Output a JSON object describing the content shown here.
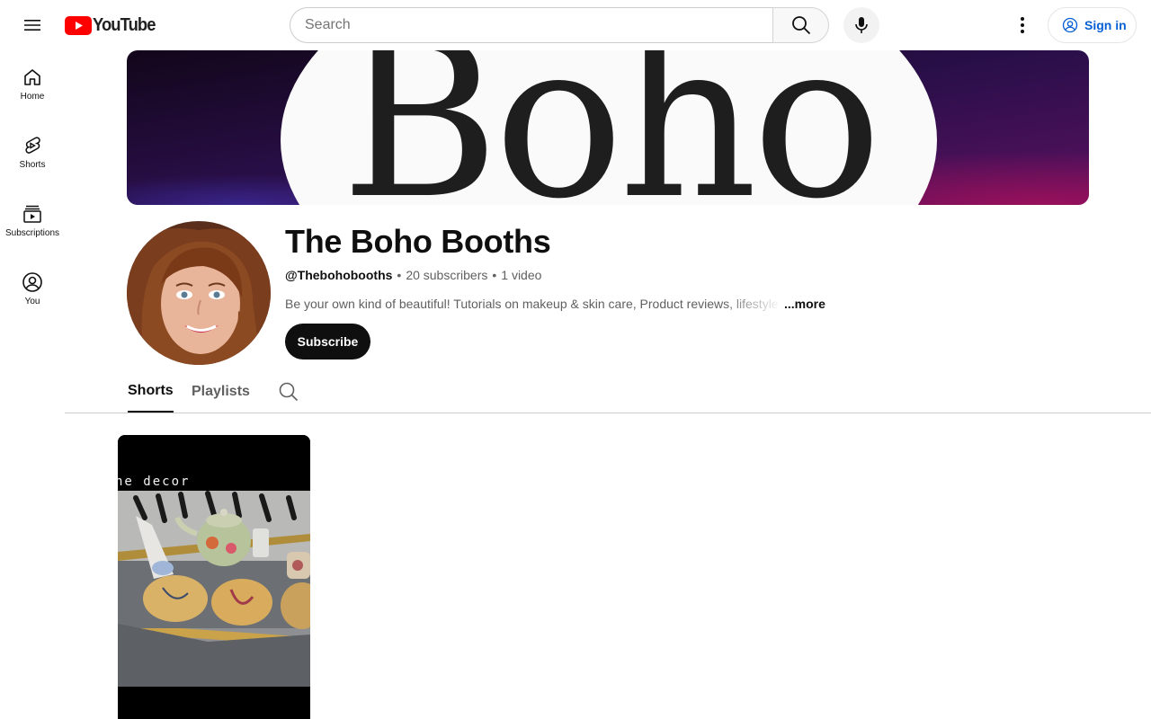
{
  "header": {
    "logo_text": "YouTube",
    "search_placeholder": "Search",
    "sign_in_label": "Sign in"
  },
  "sidebar": {
    "items": [
      {
        "label": "Home",
        "icon": "home-icon"
      },
      {
        "label": "Shorts",
        "icon": "shorts-icon"
      },
      {
        "label": "Subscriptions",
        "icon": "subscriptions-icon"
      },
      {
        "label": "You",
        "icon": "account-icon"
      }
    ]
  },
  "channel": {
    "name": "The Boho Booths",
    "handle": "@Thebohobooths",
    "subscribers": "20 subscribers",
    "videos": "1 video",
    "description": "Be your own kind of beautiful! Tutorials on makeup & skin care, Product reviews, lifestyle and",
    "more_label": "...more",
    "subscribe_label": "Subscribe",
    "banner_text": "Boho"
  },
  "tabs": [
    {
      "label": "Shorts",
      "active": true
    },
    {
      "label": "Playlists",
      "active": false
    }
  ],
  "shorts": [
    {
      "overlay_text": "ne decor"
    }
  ],
  "colors": {
    "brand_red": "#ff0000",
    "link_blue": "#065fd4",
    "text_primary": "#0f0f0f",
    "text_secondary": "#606060"
  }
}
